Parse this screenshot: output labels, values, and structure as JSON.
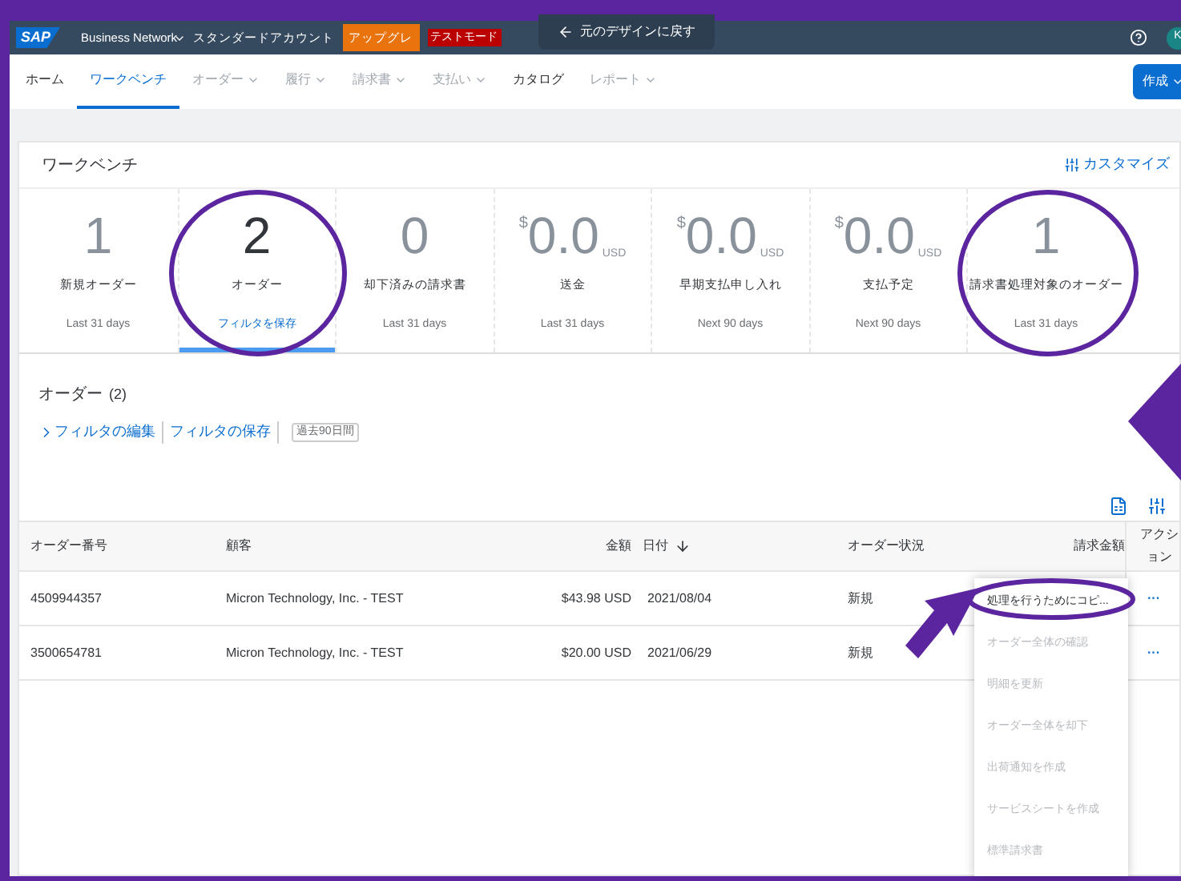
{
  "header": {
    "logo": "SAP",
    "product": "Business Network",
    "account": "スタンダードアカウント",
    "upgrade": "アップグレ",
    "test_mode": "テストモード",
    "back_link": "元のデザインに戻す",
    "avatar": "K"
  },
  "nav": {
    "tabs": [
      {
        "label": "ホーム",
        "selected": false,
        "disabled": false,
        "caret": false
      },
      {
        "label": "ワークベンチ",
        "selected": true,
        "disabled": false,
        "caret": false
      },
      {
        "label": "オーダー",
        "selected": false,
        "disabled": true,
        "caret": true
      },
      {
        "label": "履行",
        "selected": false,
        "disabled": true,
        "caret": true
      },
      {
        "label": "請求書",
        "selected": false,
        "disabled": true,
        "caret": true
      },
      {
        "label": "支払い",
        "selected": false,
        "disabled": true,
        "caret": true
      },
      {
        "label": "カタログ",
        "selected": false,
        "disabled": false,
        "caret": false
      },
      {
        "label": "レポート",
        "selected": false,
        "disabled": true,
        "caret": true
      }
    ],
    "create_button": "作成"
  },
  "workbench": {
    "title": "ワークベンチ",
    "customize": "カスタマイズ",
    "tiles": [
      {
        "kind": "count",
        "value": "1",
        "label": "新規オーダー",
        "period": "Last 31 days",
        "selected": false
      },
      {
        "kind": "count",
        "value": "2",
        "label": "オーダー",
        "period": "フィルタを保存",
        "selected": true
      },
      {
        "kind": "count",
        "value": "0",
        "label": "却下済みの請求書",
        "period": "Last 31 days",
        "selected": false
      },
      {
        "kind": "amount",
        "currency_symbol": "$",
        "value": "0.0",
        "unit": "USD",
        "label": "送金",
        "period": "Last 31 days",
        "selected": false
      },
      {
        "kind": "amount",
        "currency_symbol": "$",
        "value": "0.0",
        "unit": "USD",
        "label": "早期支払申し入れ",
        "period": "Next 90 days",
        "selected": false
      },
      {
        "kind": "amount",
        "currency_symbol": "$",
        "value": "0.0",
        "unit": "USD",
        "label": "支払予定",
        "period": "Next 90 days",
        "selected": false
      },
      {
        "kind": "count",
        "value": "1",
        "label": "請求書処理対象のオーダー",
        "period": "Last 31 days",
        "selected": false
      }
    ]
  },
  "orders": {
    "title": "オーダー",
    "count": "(2)",
    "edit_filter": "フィルタの編集",
    "save_filter": "フィルタの保存",
    "period_tag": "過去90日間",
    "table": {
      "columns": [
        "オーダー番号",
        "顧客",
        "金額",
        "日付",
        "オーダー状況",
        "請求金額",
        "アクション"
      ],
      "rows": [
        {
          "order_no": "4509944357",
          "customer": "Micron Technology, Inc. - TEST",
          "amount": "$43.98 USD",
          "date": "2021/08/04",
          "status": "新規",
          "actions": "···"
        },
        {
          "order_no": "3500654781",
          "customer": "Micron Technology, Inc. - TEST",
          "amount": "$20.00 USD",
          "date": "2021/06/29",
          "status": "新規",
          "actions": "···"
        }
      ]
    },
    "action_menu": [
      {
        "label": "処理を行うためにコピ...",
        "disabled": false
      },
      {
        "label": "オーダー全体の確認",
        "disabled": true
      },
      {
        "label": "明細を更新",
        "disabled": true
      },
      {
        "label": "オーダー全体を却下",
        "disabled": true
      },
      {
        "label": "出荷通知を作成",
        "disabled": true
      },
      {
        "label": "サービスシートを作成",
        "disabled": true
      },
      {
        "label": "標準請求書",
        "disabled": true
      }
    ]
  }
}
